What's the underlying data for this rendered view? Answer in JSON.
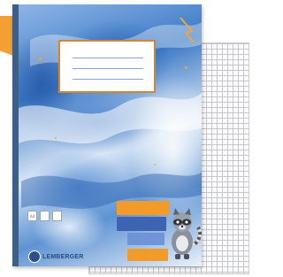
{
  "photo": {
    "subject": "notebook",
    "colors": {
      "background": "#ffffff",
      "tab": "#f2a031",
      "spine": "#3d5f86",
      "marble_dark": "#3f7cc8",
      "marble_light": "#eaf1fa",
      "label_border": "#d3862e",
      "grid_line": "#c3c6cf",
      "brand": "#2a4b85"
    },
    "brand_text": "LEMBERGER",
    "badges": [
      "A4",
      "",
      ""
    ],
    "icons": {
      "logo": "lemberger-logo-icon",
      "mascot": "raccoon-icon"
    }
  }
}
